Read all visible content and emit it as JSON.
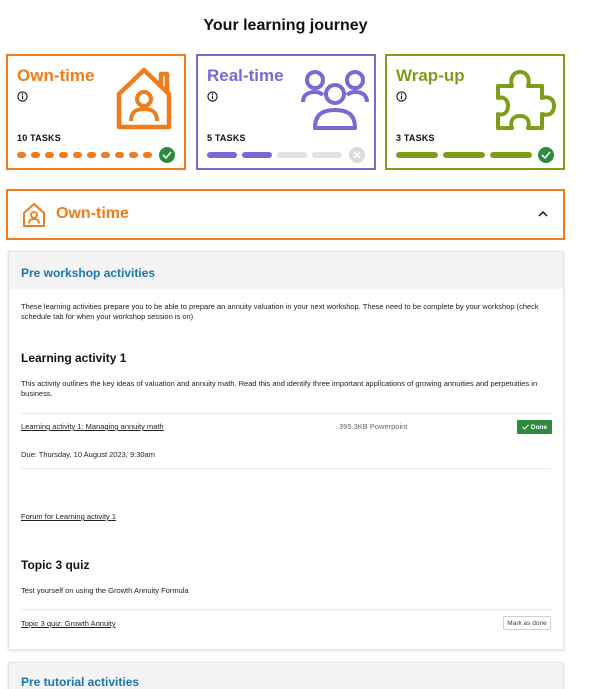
{
  "page": {
    "title": "Your learning journey"
  },
  "cards": [
    {
      "title": "Own-time",
      "tasks": "10 TASKS",
      "color": "#F07C1B",
      "icon": "house-person-icon",
      "total": 10,
      "completed": 10
    },
    {
      "title": "Real-time",
      "tasks": "5 TASKS",
      "color": "#7B68D4",
      "icon": "people-group-icon",
      "total": 5,
      "completed": 2
    },
    {
      "title": "Wrap-up",
      "tasks": "3 TASKS",
      "color": "#7E9E1A",
      "icon": "puzzle-piece-icon",
      "total": 3,
      "completed": 3
    }
  ],
  "section": {
    "title": "Own-time",
    "expanded": true
  },
  "pre_workshop": {
    "heading": "Pre workshop activities",
    "intro": "These learning activities prepare you to be able to prepare an annuity valuation in your next workshop. These need to be complete by your workshop (check schedule tab for when your workshop session is on)",
    "activity1": {
      "title": "Learning activity 1",
      "description": "This activity outlines the key ideas of valuation and annuity math. Read this and identify three important applications of growing annuities and perpetuities in business.",
      "resource_link": "Learning activity 1: Managing annuity math",
      "resource_meta": "395.3KB Powerpoint",
      "done_label": "Done",
      "due": "Due: Thursday, 10 August 2023, 9:30am",
      "forum_link": "Forum for Learning activity 1"
    },
    "quiz": {
      "title": "Topic 3 quiz",
      "description": "Test yourself on using the Growth Annuity Formula",
      "link": "Topic 3 quiz: Growth Annuity",
      "mark_label": "Mark as done"
    }
  },
  "pre_tutorial": {
    "heading": "Pre tutorial activities"
  }
}
